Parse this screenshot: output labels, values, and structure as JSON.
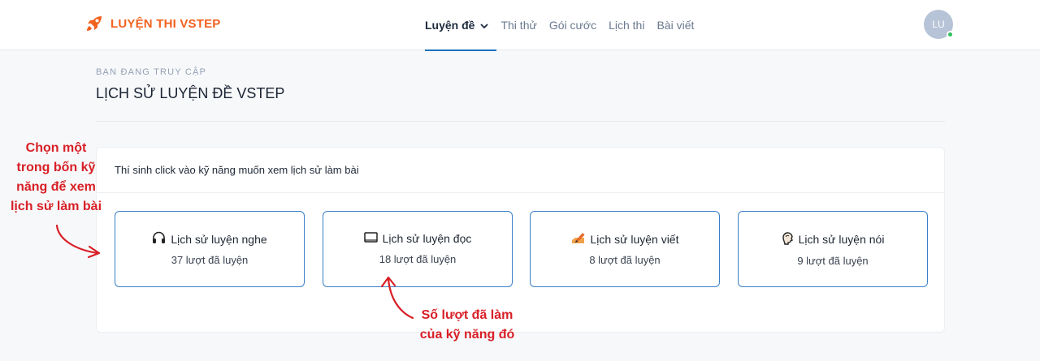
{
  "header": {
    "logo_text": "LUYỆN THI VSTEP",
    "nav": [
      {
        "label": "Luyện đề",
        "active": true
      },
      {
        "label": "Thi thử"
      },
      {
        "label": "Gói cước"
      },
      {
        "label": "Lịch thi"
      },
      {
        "label": "Bài viết"
      }
    ],
    "avatar_initials": "LU"
  },
  "page": {
    "eyebrow": "BẠN ĐANG TRUY CẬP",
    "title": "LỊCH SỬ LUYỆN ĐỀ VSTEP"
  },
  "card": {
    "instruction": "Thí sinh click vào kỹ năng muốn xem lịch sử làm bài",
    "skills": [
      {
        "title": "Lịch sử luyện nghe",
        "count": "37 lượt đã luyện",
        "icon": "headphones-icon"
      },
      {
        "title": "Lịch sử luyện đọc",
        "count": "18 lượt đã luyện",
        "icon": "book-icon"
      },
      {
        "title": "Lịch sử luyện viết",
        "count": "8 lượt đã luyện",
        "icon": "pencil-icon"
      },
      {
        "title": "Lịch sử luyện nói",
        "count": "9 lượt đã luyện",
        "icon": "speaking-head-icon"
      }
    ]
  },
  "annotations": {
    "left_lines": [
      "Chọn một",
      "trong bốn kỹ",
      "năng để xem",
      "lịch sử làm bài"
    ],
    "bottom_lines": [
      "Số lượt đã làm",
      "của kỹ năng đó"
    ]
  },
  "colors": {
    "brand": "#f2621f",
    "accent": "#1e73be",
    "card_border": "#3a7fc8",
    "annotation": "#d81f26",
    "online_dot": "#2ec15d"
  }
}
